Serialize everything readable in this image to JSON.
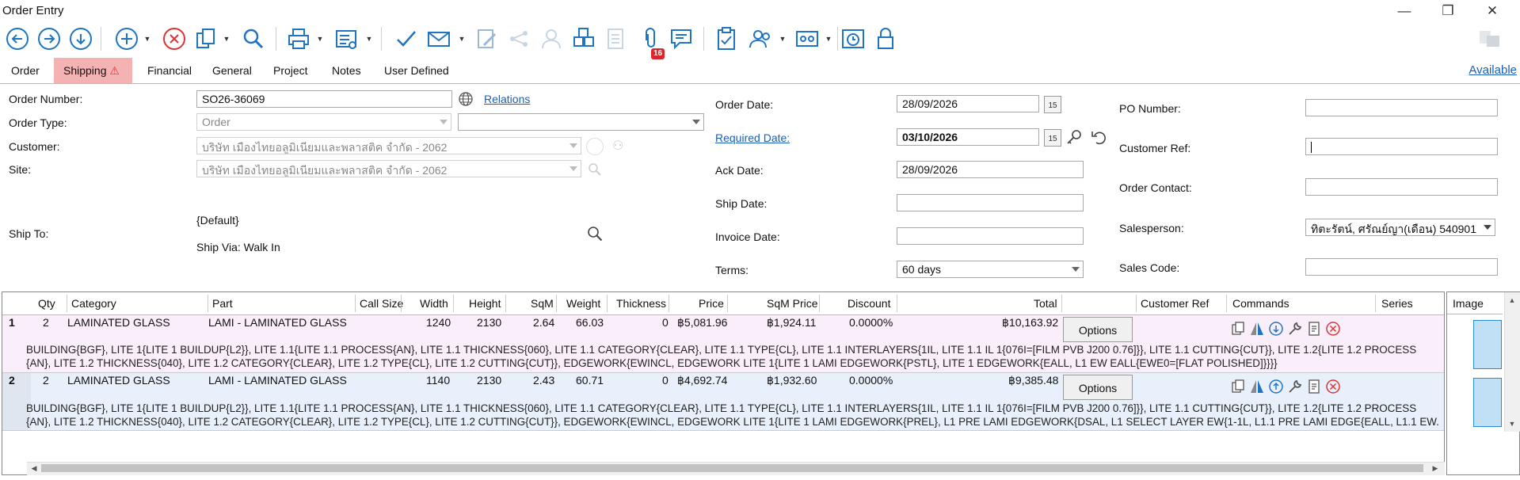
{
  "window": {
    "title": "Order Entry",
    "minimize": "—",
    "restore": "❐",
    "close": "✕"
  },
  "tabs": [
    "Order",
    "Shipping",
    "Financial",
    "General",
    "Project",
    "Notes",
    "User Defined"
  ],
  "active_tab": "Shipping",
  "notification_badge": "16",
  "available_link": "Available",
  "form": {
    "order_number_label": "Order Number:",
    "order_number": "SO26-36069",
    "relations_link": "Relations",
    "order_type_label": "Order Type:",
    "order_type": "Order",
    "customer_label": "Customer:",
    "customer": "บริษัท เมืองไทยอลูมิเนียมและพลาสติค  จำกัด - 2062",
    "site_label": "Site:",
    "site": "บริษัท เมืองไทยอลูมิเนียมและพลาสติค  จำกัด - 2062",
    "ship_to_label": "Ship To:",
    "ship_to_default": "{Default}",
    "ship_via": "Ship Via: Walk In",
    "order_date_label": "Order Date:",
    "order_date": "28/09/2026",
    "required_date_label": "Required Date:",
    "required_date": "03/10/2026",
    "ack_date_label": "Ack Date:",
    "ack_date": "28/09/2026",
    "ship_date_label": "Ship Date:",
    "ship_date": "",
    "invoice_date_label": "Invoice Date:",
    "invoice_date": "",
    "terms_label": "Terms:",
    "terms": "60 days",
    "po_number_label": "PO Number:",
    "po_number": "",
    "customer_ref_label": "Customer Ref:",
    "customer_ref": "",
    "order_contact_label": "Order Contact:",
    "order_contact": "",
    "salesperson_label": "Salesperson:",
    "salesperson": "ทิตะรัตน์, ศรัณย์ญา(เดือน) 540901",
    "sales_code_label": "Sales Code:",
    "sales_code": "",
    "calendar_icon_text": "15"
  },
  "grid": {
    "columns": [
      "Qty",
      "Category",
      "Part",
      "Call Size",
      "Width",
      "Height",
      "SqM",
      "Weight",
      "Thickness",
      "Price",
      "SqM Price",
      "Discount",
      "Total",
      "Customer Ref",
      "Commands",
      "Series"
    ],
    "image_header": "Image",
    "options_label": "Options",
    "rows": [
      {
        "num": "1",
        "qty": "2",
        "category": "LAMINATED GLASS",
        "part": "LAMI - LAMINATED GLASS",
        "width": "1240",
        "height": "2130",
        "sqm": "2.64",
        "weight": "66.03",
        "thickness": "0",
        "price": "฿5,081.96",
        "sqm_price": "฿1,924.11",
        "discount": "0.0000%",
        "total": "฿10,163.92",
        "desc1": "BUILDING{BGF}, LITE 1{LITE 1 BUILDUP{L2}}, LITE 1.1{LITE 1.1 PROCESS{AN}, LITE 1.1 THICKNESS{060}, LITE 1.1 CATEGORY{CLEAR}, LITE 1.1 TYPE{CL}, LITE 1.1 INTERLAYERS{1IL, LITE 1.1 IL 1{076I=[FILM PVB J200 0.76]}}, LITE 1.1 CUTTING{CUT}}, LITE 1.2{LITE 1.2 PROCESS",
        "desc2": "{AN}, LITE 1.2 THICKNESS{040}, LITE 1.2 CATEGORY{CLEAR}, LITE 1.2 TYPE{CL}, LITE 1.2 CUTTING{CUT}}, EDGEWORK{EWINCL, EDGEWORK LITE 1{LITE 1 LAMI EDGEWORK{PSTL}, LITE 1 EDGEWORK{EALL, L1 EW EALL{EWE0=[FLAT POLISHED]}}}}"
      },
      {
        "num": "2",
        "qty": "2",
        "category": "LAMINATED GLASS",
        "part": "LAMI - LAMINATED GLASS",
        "width": "1140",
        "height": "2130",
        "sqm": "2.43",
        "weight": "60.71",
        "thickness": "0",
        "price": "฿4,692.74",
        "sqm_price": "฿1,932.60",
        "discount": "0.0000%",
        "total": "฿9,385.48",
        "desc1": "BUILDING{BGF}, LITE 1{LITE 1 BUILDUP{L2}}, LITE 1.1{LITE 1.1 PROCESS{AN}, LITE 1.1 THICKNESS{060}, LITE 1.1 CATEGORY{CLEAR}, LITE 1.1 TYPE{CL}, LITE 1.1 INTERLAYERS{1IL, LITE 1.1 IL 1{076I=[FILM PVB J200 0.76]}}, LITE 1.1 CUTTING{CUT}}, LITE 1.2{LITE 1.2 PROCESS",
        "desc2": "{AN}, LITE 1.2 THICKNESS{040}, LITE 1.2 CATEGORY{CLEAR}, LITE 1.2 TYPE{CL}, LITE 1.2 CUTTING{CUT}}, EDGEWORK{EWINCL, EDGEWORK LITE 1{LITE 1 LAMI EDGEWORK{PREL}, L1 PRE LAMI EDGEWORK{DSAL, L1 SELECT LAYER EW{1-1L, L1.1 PRE LAMI EDGE{EALL, L1.1 EW..."
      }
    ]
  },
  "colors": {
    "active_tab": "#f5b2b2",
    "row1_bg": "#fbeefb",
    "row2_bg": "#e8f0fb",
    "link": "#1a5fb4",
    "accent_blue": "#1f74c4",
    "badge": "#d9262c"
  }
}
